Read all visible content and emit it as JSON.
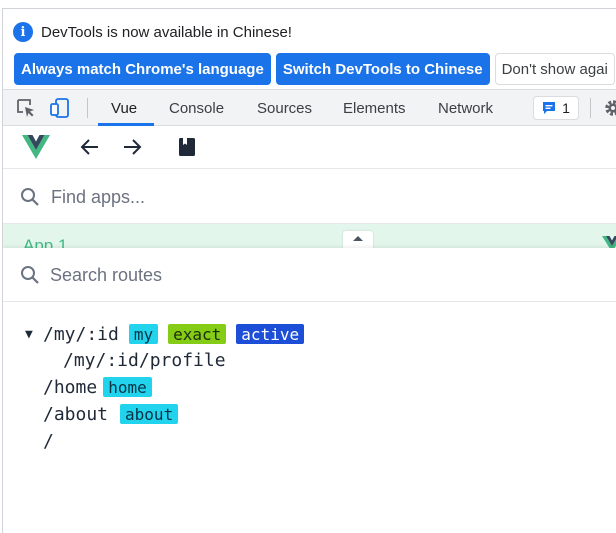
{
  "infobar": {
    "message": "DevTools is now available in Chinese!",
    "buttons": {
      "match": "Always match Chrome's language",
      "switch": "Switch DevTools to Chinese",
      "dont_show": "Don't show agai"
    }
  },
  "devtools": {
    "tabs": [
      "Vue",
      "Console",
      "Sources",
      "Elements",
      "Network"
    ],
    "active_tab": "Vue",
    "issues_count": "1"
  },
  "vue": {
    "find_apps_placeholder": "Find apps...",
    "app_label": "App 1",
    "routes_placeholder": "Search routes",
    "routes": [
      {
        "path": "/my/:id",
        "expanded": true,
        "tags": [
          {
            "label": "my",
            "color": "cyan"
          },
          {
            "label": "exact",
            "color": "green"
          },
          {
            "label": "active",
            "color": "blue"
          }
        ]
      },
      {
        "path": "/my/:id/profile",
        "tags": []
      },
      {
        "path": "/home",
        "tags": [
          {
            "label": "home",
            "color": "cyan"
          }
        ]
      },
      {
        "path": "/about",
        "tags": [
          {
            "label": "about",
            "color": "cyan"
          }
        ]
      },
      {
        "path": "/",
        "tags": []
      }
    ]
  },
  "colors": {
    "chrome_blue": "#1a73e8",
    "vue_green": "#42b883",
    "tag_cyan": "#22d3ee",
    "tag_green": "#84cc16",
    "tag_blue": "#1d4ed8"
  },
  "icons": [
    "info-icon",
    "inspect-element-icon",
    "device-toolbar-icon",
    "issues-icon",
    "settings-gear-icon",
    "vue-logo-icon",
    "back-arrow-icon",
    "forward-arrow-icon",
    "docs-book-icon",
    "search-icon",
    "chevron-up-icon",
    "caret-down-icon"
  ]
}
